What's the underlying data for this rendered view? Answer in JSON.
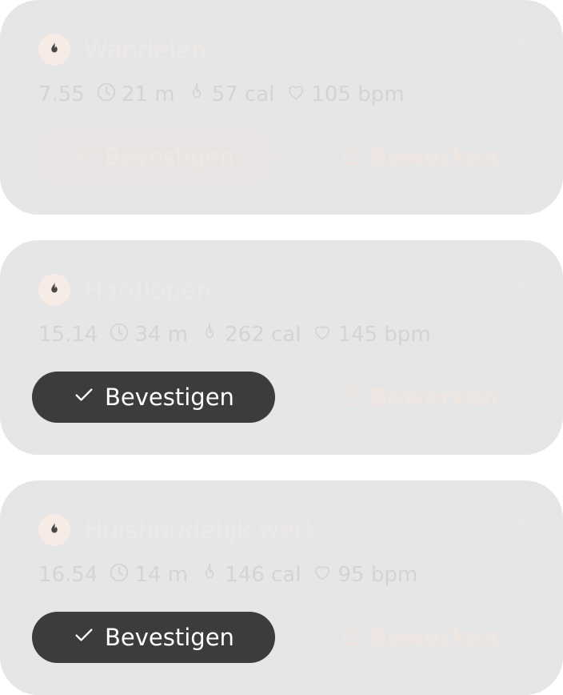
{
  "colors": {
    "card_bg": "#e7e6e6",
    "button_active": "#3d3b3b",
    "button_disabled": "#e8e5e4",
    "muted_text": "#d6d4d3",
    "title_text": "#ece8e6",
    "badge_bg": "#f7ebe5"
  },
  "activities": [
    {
      "title": "Wandelen",
      "time": "7.55",
      "duration": "21 m",
      "calories": "57 cal",
      "heart_rate": "105 bpm",
      "confirm_label": "Bevestigen",
      "edit_label": "Bewerken",
      "confirm_state": "disabled",
      "icon": "flame-icon"
    },
    {
      "title": "Hardlopen",
      "time": "15.14",
      "duration": "34 m",
      "calories": "262 cal",
      "heart_rate": "145 bpm",
      "confirm_label": "Bevestigen",
      "edit_label": "Bewerken",
      "confirm_state": "active",
      "icon": "flame-icon"
    },
    {
      "title": "Huishoudelijk werk",
      "time": "16.54",
      "duration": "14 m",
      "calories": "146 cal",
      "heart_rate": "95 bpm",
      "confirm_label": "Bevestigen",
      "edit_label": "Bewerken",
      "confirm_state": "active",
      "icon": "flame-icon"
    }
  ]
}
